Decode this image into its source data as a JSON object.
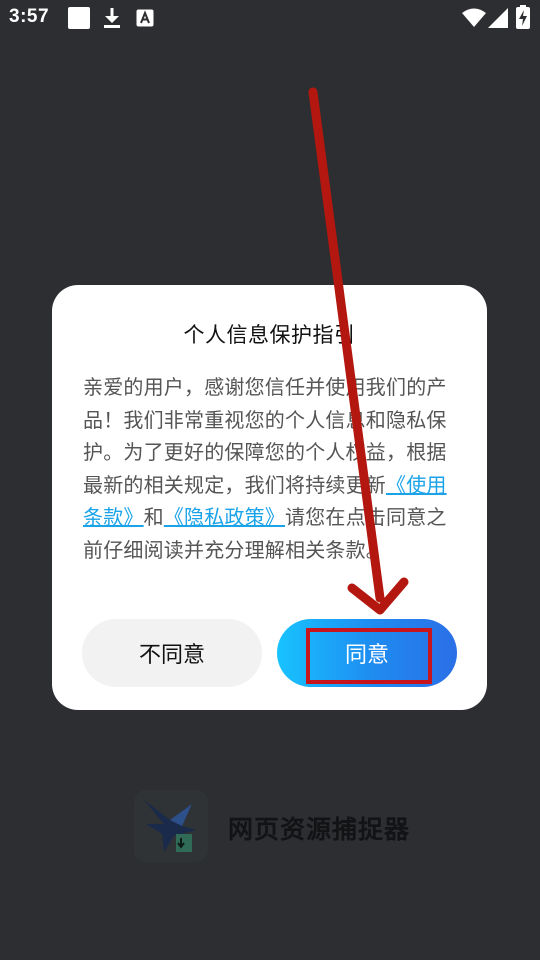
{
  "status_bar": {
    "time": "3:57",
    "notification_icons": [
      "blank-square-icon",
      "download-icon",
      "font-a-icon"
    ],
    "system_icons": [
      "wifi-icon",
      "signal-icon",
      "battery-charging-icon"
    ]
  },
  "splash": {
    "app_name": "网页资源捕捉器",
    "logo": "bird-download-logo-icon"
  },
  "dialog": {
    "title": "个人信息保护指引",
    "body_intro": "亲爱的用户，感谢您信任并使用我们的产品！我们非常重视您的个人信息和隐私保护。为了更好的保障您的个人权益，根据最新的相关规定，我们将持续更新",
    "terms_link": "《使用条款》",
    "conjunction": "和",
    "privacy_link": "《隐私政策》",
    "body_outro": "请您在点击同意之前仔细阅读并充分理解相关条款。",
    "decline_label": "不同意",
    "accept_label": "同意"
  },
  "annotation": {
    "arrow_color": "#b3170f",
    "highlight_color": "#c8141d"
  }
}
